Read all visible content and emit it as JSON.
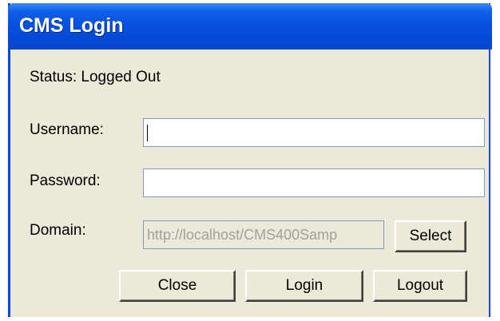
{
  "window": {
    "title": "CMS Login"
  },
  "status": {
    "text": "Status: Logged Out"
  },
  "form": {
    "username_label": "Username:",
    "username_value": "",
    "password_label": "Password:",
    "password_value": "",
    "domain_label": "Domain:",
    "domain_value": "http://localhost/CMS400Samp"
  },
  "buttons": {
    "select": "Select",
    "close": "Close",
    "login": "Login",
    "logout": "Logout"
  }
}
